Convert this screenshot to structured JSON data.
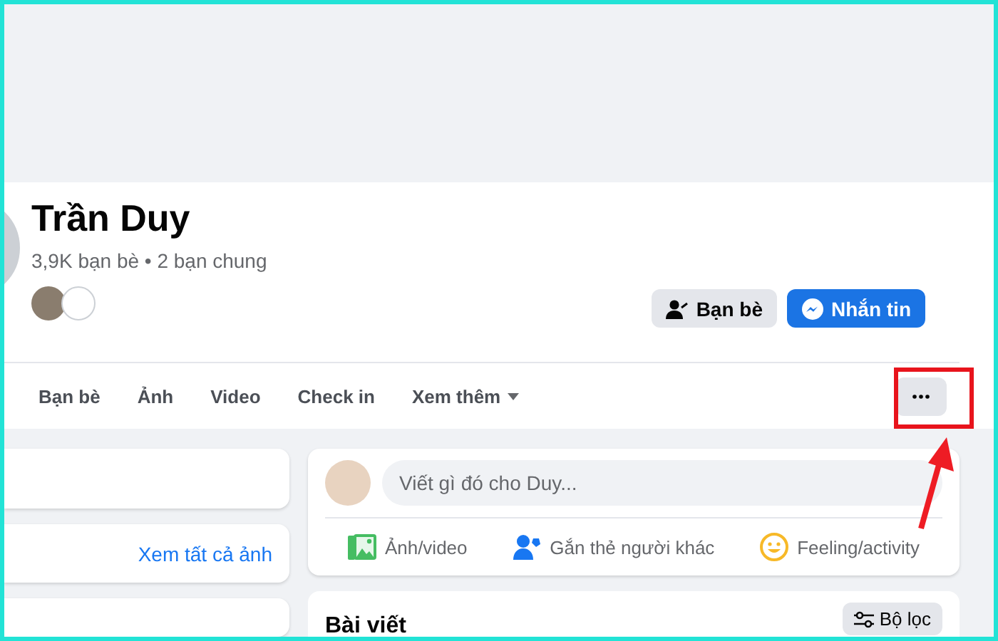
{
  "profile": {
    "name": "Trần Duy",
    "stats": "3,9K bạn bè • 2 bạn chung",
    "buttons": [
      {
        "label": "Bạn bè",
        "kind": "secondary"
      },
      {
        "label": "Nhắn tin",
        "kind": "primary"
      }
    ]
  },
  "tabs": [
    {
      "label": "Bạn bè",
      "kind": "plain"
    },
    {
      "label": "Ảnh",
      "kind": "plain"
    },
    {
      "label": "Video",
      "kind": "plain"
    },
    {
      "label": "Check in",
      "kind": "plain"
    },
    {
      "label": "Xem thêm",
      "kind": "dropdown"
    }
  ],
  "photos_card": {
    "link": "Xem tất cả ảnh"
  },
  "composer": {
    "placeholder": "Viết gì đó cho Duy...",
    "actions": [
      {
        "label": "Ảnh/video",
        "kind": "photo"
      },
      {
        "label": "Gắn thẻ người khác",
        "kind": "tag"
      },
      {
        "label": "Feeling/activity",
        "kind": "feeling"
      }
    ]
  },
  "posts": {
    "title": "Bài viết",
    "filter": "Bộ lọc"
  }
}
